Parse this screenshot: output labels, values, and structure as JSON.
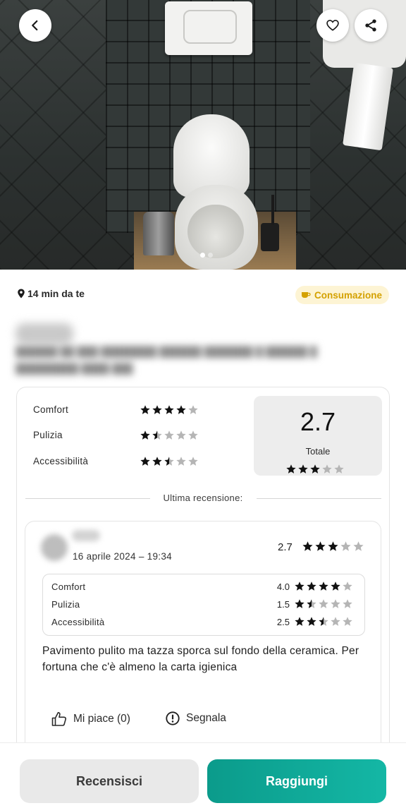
{
  "header": {
    "back_icon": "chevron-left-icon",
    "favorite_icon": "heart-icon",
    "share_icon": "share-icon"
  },
  "info": {
    "distance": "14 min da te",
    "badge": "Consumazione",
    "badge_color": "#d4a100"
  },
  "ratings": {
    "criteria": [
      {
        "label": "Comfort",
        "stars": 4.0
      },
      {
        "label": "Pulizia",
        "stars": 1.5
      },
      {
        "label": "Accessibilità",
        "stars": 2.5
      }
    ],
    "total_value": "2.7",
    "total_label": "Totale",
    "total_stars": 3.0
  },
  "last_review": {
    "divider_label": "Ultima recensione:",
    "date": "16 aprile 2024 – 19:34",
    "score": "2.7",
    "score_stars": 3.0,
    "criteria": [
      {
        "label": "Comfort",
        "value": "4.0",
        "stars": 4.0
      },
      {
        "label": "Pulizia",
        "value": "1.5",
        "stars": 1.5
      },
      {
        "label": "Accessibilità",
        "value": "2.5",
        "stars": 2.5
      }
    ],
    "text": "Pavimento pulito ma tazza sporca sul fondo della ceramica. Per fortuna che c'è almeno la carta igienica",
    "like_label": "Mi piace (0)",
    "report_label": "Segnala"
  },
  "bottom": {
    "review_button": "Recensisci",
    "reach_button": "Raggiungi",
    "accent_color": "#0fa898"
  },
  "colors": {
    "star_filled": "#111111",
    "star_empty": "#b5b5b5"
  }
}
